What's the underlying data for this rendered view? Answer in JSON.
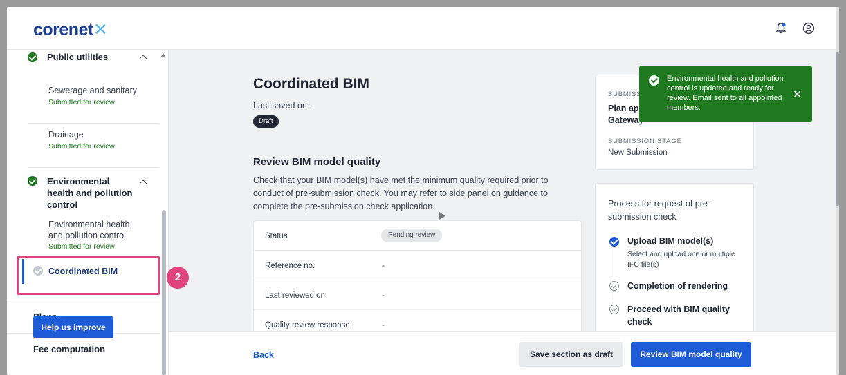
{
  "brand": {
    "name": "corenet",
    "suffix": "✕"
  },
  "header_icons": [
    "bell-notification-icon",
    "user-account-icon"
  ],
  "sidebar": {
    "groups": [
      {
        "title": "Public utilities",
        "items": [
          {
            "label": "Sewerage and sanitary",
            "status": "Submitted for review"
          },
          {
            "label": "Drainage",
            "status": "Submitted for review"
          }
        ]
      },
      {
        "title": "Environmental health and pollution control",
        "items": [
          {
            "label": "Environmental health and pollution control",
            "status": "Submitted for review"
          },
          {
            "label": "Coordinated BIM",
            "status": ""
          }
        ]
      }
    ],
    "plans": "Plans",
    "fee": "Fee computation",
    "help": "Help us improve",
    "step_badge": "2"
  },
  "main": {
    "title": "Coordinated BIM",
    "saved": "Last saved on -",
    "draft_badge": "Draft",
    "section_title": "Review BIM model quality",
    "section_desc": "Check that your BIM model(s) have met the minimum quality required prior to conduct of pre-submission check. You may refer to side panel on guidance to complete the pre-submission check application.",
    "rows": [
      {
        "key": "Status",
        "value": "Pending review"
      },
      {
        "key": "Reference no.",
        "value": "-"
      },
      {
        "key": "Last reviewed on",
        "value": "-"
      },
      {
        "key": "Quality review response",
        "value": "-"
      }
    ]
  },
  "submission_card": {
    "label1": "SUBMISS",
    "val1": "Plan ap Gateway",
    "label2": "SUBMISSION STAGE",
    "val2": "New Submission"
  },
  "process": {
    "title": "Process for request of pre-submission check",
    "steps": [
      {
        "title": "Upload BIM model(s)",
        "sub": "Select and upload one or multiple IFC file(s)",
        "done": true
      },
      {
        "title": "Completion of rendering",
        "sub": "",
        "done": false
      },
      {
        "title": "Proceed with BIM quality check",
        "sub": "",
        "done": false
      }
    ]
  },
  "toast": {
    "message": "Environmental health and pollution control is updated and ready for review. Email sent to all appointed members.",
    "close": "✕"
  },
  "footer": {
    "back": "Back",
    "save_draft": "Save section as draft",
    "review": "Review BIM model quality"
  },
  "colors": {
    "brand_blue": "#1e5bd6",
    "success_green": "#1f7a1f",
    "highlight_pink": "#e0437e"
  }
}
